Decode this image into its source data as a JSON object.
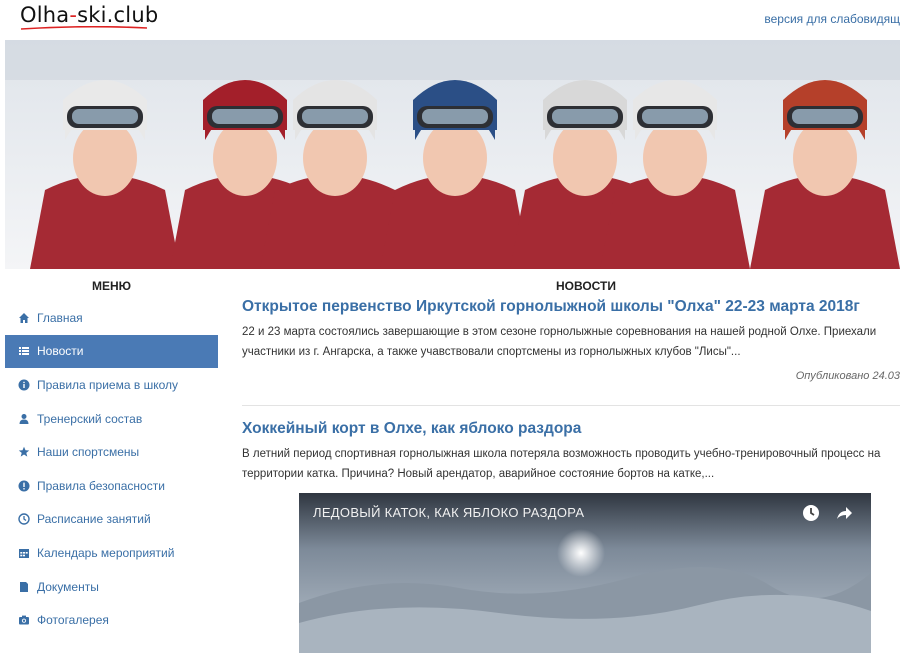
{
  "header": {
    "logo_text_left": "Olha",
    "logo_text_dash": "-",
    "logo_text_right": "ski.club",
    "vision_link": "версия для слабовидящ"
  },
  "colors": {
    "accent": "#3a6fa6",
    "menu_active": "#4a7ab5",
    "logo_dash": "#dd2222"
  },
  "menu": {
    "title": "МЕНЮ",
    "items": [
      {
        "label": "Главная",
        "icon": "home-icon",
        "active": false
      },
      {
        "label": "Новости",
        "icon": "list-icon",
        "active": true
      },
      {
        "label": "Правила приема в школу",
        "icon": "info-icon",
        "active": false
      },
      {
        "label": "Тренерский состав",
        "icon": "user-icon",
        "active": false
      },
      {
        "label": "Наши спортсмены",
        "icon": "star-icon",
        "active": false
      },
      {
        "label": "Правила безопасности",
        "icon": "alert-icon",
        "active": false
      },
      {
        "label": "Расписание занятий",
        "icon": "clock-icon",
        "active": false
      },
      {
        "label": "Календарь мероприятий",
        "icon": "calendar-icon",
        "active": false
      },
      {
        "label": "Документы",
        "icon": "document-icon",
        "active": false
      },
      {
        "label": "Фотогалерея",
        "icon": "camera-icon",
        "active": false
      }
    ]
  },
  "news": {
    "title": "НОВОСТИ",
    "articles": [
      {
        "title": "Открытое первенство Иркутской горнолыжной школы \"Олха\" 22-23 марта 2018г",
        "text": "22 и 23 марта состоялись завершающие в этом сезоне горнолыжные соревнования на нашей родной Олхе. Приехали участники из г. Ангарска, а также учавствовали спортсмены из горнолыжных клубов \"Лисы\"...",
        "meta": "Опубликовано 24.03"
      },
      {
        "title": "Хоккейный корт в Олхе, как яблоко раздора",
        "text": "В летний период спортивная горнолыжная школа потеряла возможность проводить учебно-тренировочный процесс на территории катка. Причина? Новый арендатор, аварийное состояние бортов на катке,..."
      }
    ],
    "video": {
      "title": "ЛЕДОВЫЙ КАТОК, КАК ЯБЛОКО РАЗДОРА",
      "icons": [
        "clock-icon",
        "share-icon"
      ]
    }
  },
  "banner": {
    "alt": "children-skiers-photo",
    "helmet_colors": [
      "#e9e9e9",
      "#a31f2a",
      "#e4e4e4",
      "#2b4f86",
      "#d8d8d8",
      "#e7e7e7",
      "#b5402a"
    ]
  }
}
